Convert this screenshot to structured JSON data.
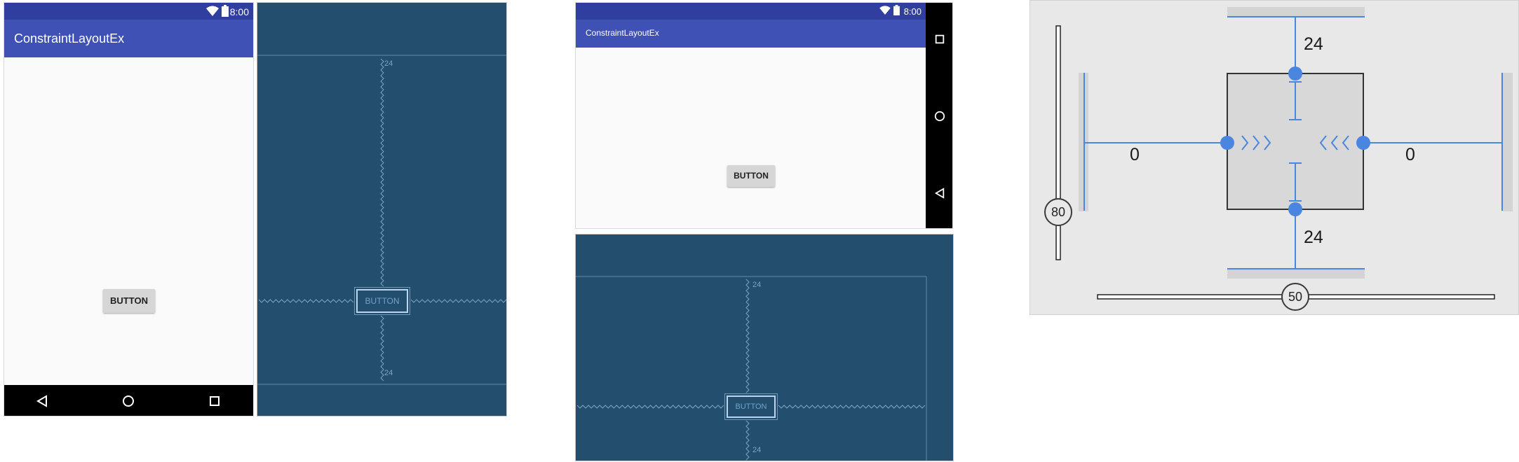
{
  "portrait_device": {
    "status_time": "8:00",
    "app_title": "ConstraintLayoutEx",
    "button_label": "BUTTON"
  },
  "portrait_blueprint": {
    "button_label": "BUTTON",
    "margin_top": "24",
    "margin_bottom": "24"
  },
  "landscape_device": {
    "status_time": "8:00",
    "app_title": "ConstraintLayoutEx",
    "button_label": "BUTTON"
  },
  "landscape_blueprint": {
    "button_label": "BUTTON",
    "margin_top": "24",
    "margin_bottom": "24"
  },
  "constraint_inspector": {
    "margin_top": "24",
    "margin_bottom": "24",
    "margin_left": "0",
    "margin_right": "0",
    "vertical_bias": "80",
    "horizontal_bias": "50",
    "colors": {
      "accent": "#4a86e0",
      "background": "#e8e8e8"
    }
  },
  "icons": [
    "wifi-icon",
    "battery-icon",
    "back-nav-icon",
    "home-nav-icon",
    "recents-nav-icon"
  ]
}
